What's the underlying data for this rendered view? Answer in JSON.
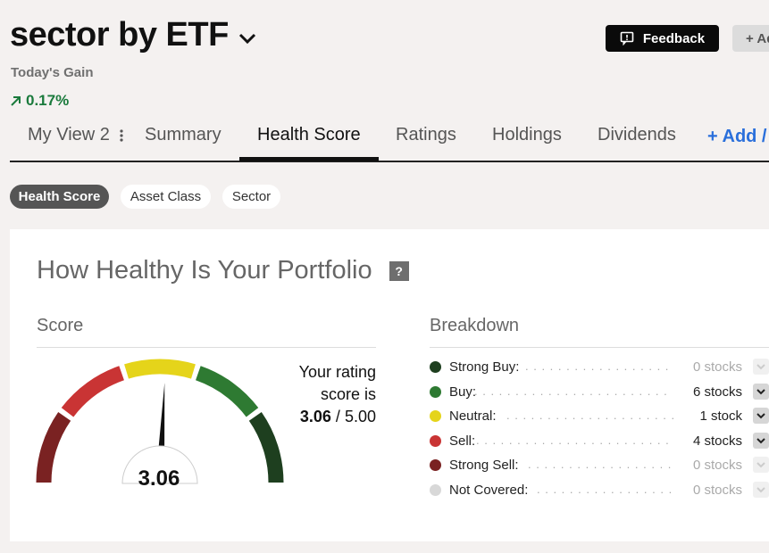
{
  "header": {
    "title": "sector by ETF",
    "gain_label": "Today's Gain",
    "gain_value": "0.17%",
    "feedback_label": "Feedback",
    "add_label": "+ Ad"
  },
  "tabs": [
    {
      "label": "My View 2"
    },
    {
      "label": "Summary"
    },
    {
      "label": "Health Score"
    },
    {
      "label": "Ratings"
    },
    {
      "label": "Holdings"
    },
    {
      "label": "Dividends"
    },
    {
      "label": "+ Add /"
    }
  ],
  "pills": [
    {
      "label": "Health Score"
    },
    {
      "label": "Asset Class"
    },
    {
      "label": "Sector"
    }
  ],
  "card": {
    "title": "How Healthy Is Your Portfolio",
    "help": "?",
    "score_head": "Score",
    "breakdown_head": "Breakdown",
    "gauge_value": "3.06",
    "gauge_score": 3.06,
    "gauge_max": 5,
    "rating_line1": "Your rating",
    "rating_line2": "score is",
    "rating_score": "3.06",
    "rating_sep": "/",
    "rating_max": "5.00"
  },
  "breakdown": [
    {
      "label": "Strong Buy:",
      "count": "0 stocks",
      "color": "#1e3f1f",
      "muted": true
    },
    {
      "label": "Buy:",
      "count": "6 stocks",
      "color": "#2e7a32",
      "muted": false
    },
    {
      "label": "Neutral:",
      "count": "1 stock",
      "color": "#e5d41a",
      "muted": false
    },
    {
      "label": "Sell:",
      "count": "4 stocks",
      "color": "#c93434",
      "muted": false
    },
    {
      "label": "Strong Sell:",
      "count": "0 stocks",
      "color": "#7a2222",
      "muted": true
    },
    {
      "label": "Not Covered:",
      "count": "0 stocks",
      "color": "#d8d8d8",
      "muted": true
    }
  ],
  "colors": {
    "gain": "#1a7a3c",
    "link": "#2a6fdb",
    "gauge_segments": [
      "#7a2222",
      "#c93434",
      "#e5d41a",
      "#2e7a32",
      "#1e3f1f"
    ]
  }
}
